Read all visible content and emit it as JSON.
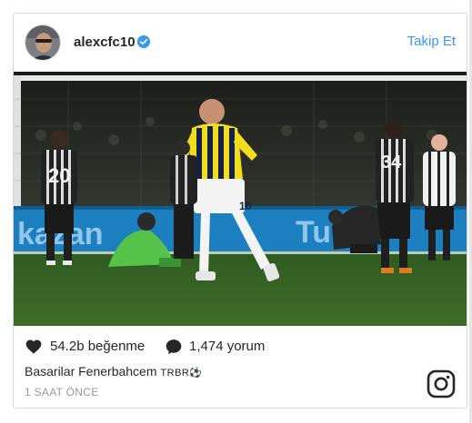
{
  "post": {
    "username": "alexcfc10",
    "follow_label": "Takip Et",
    "likes": "54.2b beğenme",
    "comments": "1,474 yorum",
    "caption_text": "Basarilar Fenerbahcem ",
    "caption_tag": "TRBR⚽",
    "timestamp": "1 SAAT ÖNCE"
  },
  "photo": {
    "player_number": "10",
    "opponent_numbers": [
      "20",
      "34"
    ],
    "ad_board_left": "kazan",
    "ad_board_right": "Turk"
  },
  "icons": {
    "verified": "verified-badge-icon",
    "like": "heart-icon",
    "comment": "speech-bubble-icon",
    "logo": "instagram-icon"
  },
  "colors": {
    "accent": "#3897f0",
    "text": "#262626",
    "muted": "#999999"
  }
}
